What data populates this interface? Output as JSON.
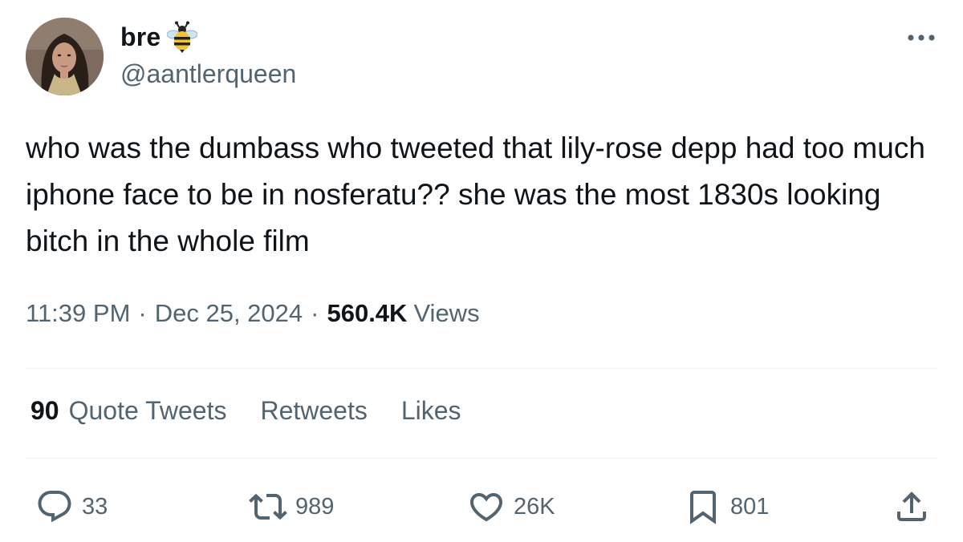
{
  "author": {
    "display_name": "bre",
    "name_emoji": "bee-emoji",
    "handle": "@aantlerqueen",
    "avatar": "avatar-photo"
  },
  "more_icon": "more-dots-icon",
  "tweet": {
    "text": "who was the dumbass who tweeted that lily-rose depp had too much iphone face to be in nosferatu?? she was the most 1830s looking bitch in the whole film"
  },
  "meta": {
    "time": "11:39 PM",
    "separator": "·",
    "date": "Dec 25, 2024",
    "views_count": "560.4K",
    "views_label": "Views"
  },
  "stats": {
    "quote_count": "90",
    "quote_label": "Quote Tweets",
    "retweets_label": "Retweets",
    "likes_label": "Likes"
  },
  "actions": {
    "reply": {
      "icon": "reply-icon",
      "count": "33"
    },
    "retweet": {
      "icon": "retweet-icon",
      "count": "989"
    },
    "like": {
      "icon": "heart-icon",
      "count": "26K"
    },
    "bookmark": {
      "icon": "bookmark-icon",
      "count": "801"
    },
    "share": {
      "icon": "share-icon"
    }
  },
  "colors": {
    "text_primary": "#0f1419",
    "text_secondary": "#536471",
    "divider": "#eff3f4",
    "background": "#ffffff"
  }
}
